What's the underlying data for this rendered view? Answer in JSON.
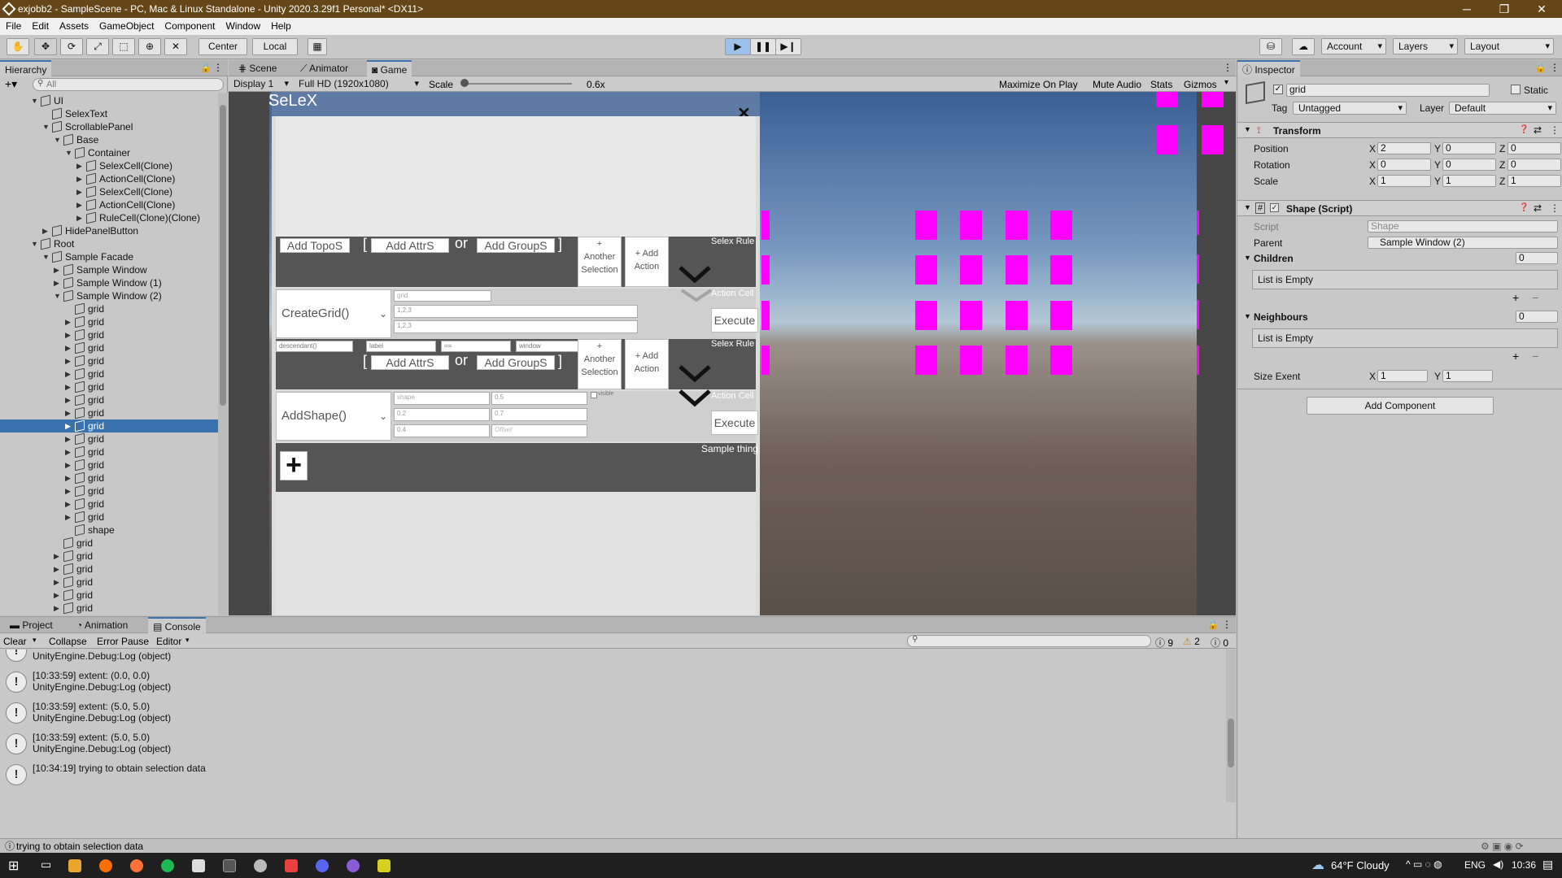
{
  "window": {
    "title": "exjobb2 - SampleScene - PC, Mac & Linux Standalone - Unity 2020.3.29f1 Personal* <DX11>",
    "minimize": "─",
    "maximize": "❐",
    "close": "✕"
  },
  "menu": [
    "File",
    "Edit",
    "Assets",
    "GameObject",
    "Component",
    "Window",
    "Help"
  ],
  "toolbar": {
    "center": "Center",
    "local": "Local",
    "account": "Account",
    "layers": "Layers",
    "layout": "Layout"
  },
  "hierarchy": {
    "tab": "Hierarchy",
    "search_placeholder": "All",
    "rows": [
      {
        "label": "UI",
        "indent": 0,
        "arrow": "▼"
      },
      {
        "label": "SelexText",
        "indent": 1,
        "arrow": ""
      },
      {
        "label": "ScrollablePanel",
        "indent": 1,
        "arrow": "▼"
      },
      {
        "label": "Base",
        "indent": 2,
        "arrow": "▼"
      },
      {
        "label": "Container",
        "indent": 3,
        "arrow": "▼"
      },
      {
        "label": "SelexCell(Clone)",
        "indent": 4,
        "arrow": "▶"
      },
      {
        "label": "ActionCell(Clone)",
        "indent": 4,
        "arrow": "▶"
      },
      {
        "label": "SelexCell(Clone)",
        "indent": 4,
        "arrow": "▶"
      },
      {
        "label": "ActionCell(Clone)",
        "indent": 4,
        "arrow": "▶"
      },
      {
        "label": "RuleCell(Clone)(Clone)",
        "indent": 4,
        "arrow": "▶"
      },
      {
        "label": "HidePanelButton",
        "indent": 1,
        "arrow": "▶"
      },
      {
        "label": "Root",
        "indent": 0,
        "arrow": "▼"
      },
      {
        "label": "Sample Facade",
        "indent": 1,
        "arrow": "▼"
      },
      {
        "label": "Sample Window",
        "indent": 2,
        "arrow": "▶"
      },
      {
        "label": "Sample Window (1)",
        "indent": 2,
        "arrow": "▶"
      },
      {
        "label": "Sample Window (2)",
        "indent": 2,
        "arrow": "▼"
      },
      {
        "label": "grid",
        "indent": 3,
        "arrow": ""
      },
      {
        "label": "grid",
        "indent": 3,
        "arrow": "▶"
      },
      {
        "label": "grid",
        "indent": 3,
        "arrow": "▶"
      },
      {
        "label": "grid",
        "indent": 3,
        "arrow": "▶"
      },
      {
        "label": "grid",
        "indent": 3,
        "arrow": "▶"
      },
      {
        "label": "grid",
        "indent": 3,
        "arrow": "▶"
      },
      {
        "label": "grid",
        "indent": 3,
        "arrow": "▶"
      },
      {
        "label": "grid",
        "indent": 3,
        "arrow": "▶"
      },
      {
        "label": "grid",
        "indent": 3,
        "arrow": "▶"
      },
      {
        "label": "grid",
        "indent": 3,
        "arrow": "▶",
        "selected": true
      },
      {
        "label": "grid",
        "indent": 3,
        "arrow": "▶"
      },
      {
        "label": "grid",
        "indent": 3,
        "arrow": "▶"
      },
      {
        "label": "grid",
        "indent": 3,
        "arrow": "▶"
      },
      {
        "label": "grid",
        "indent": 3,
        "arrow": "▶"
      },
      {
        "label": "grid",
        "indent": 3,
        "arrow": "▶"
      },
      {
        "label": "grid",
        "indent": 3,
        "arrow": "▶"
      },
      {
        "label": "grid",
        "indent": 3,
        "arrow": "▶"
      },
      {
        "label": "shape",
        "indent": 3,
        "arrow": ""
      },
      {
        "label": "grid",
        "indent": 2,
        "arrow": ""
      },
      {
        "label": "grid",
        "indent": 2,
        "arrow": "▶"
      },
      {
        "label": "grid",
        "indent": 2,
        "arrow": "▶"
      },
      {
        "label": "grid",
        "indent": 2,
        "arrow": "▶"
      },
      {
        "label": "grid",
        "indent": 2,
        "arrow": "▶"
      },
      {
        "label": "grid",
        "indent": 2,
        "arrow": "▶"
      }
    ]
  },
  "game": {
    "tabs": [
      "Scene",
      "Animator",
      "Game"
    ],
    "display": "Display 1",
    "resolution": "Full HD (1920x1080)",
    "scale_label": "Scale",
    "scale_value": "0.6x",
    "maximize": "Maximize On Play",
    "mute": "Mute Audio",
    "stats": "Stats",
    "gizmos": "Gizmos"
  },
  "selex": {
    "title": "SeLeX",
    "close": "✕",
    "add_topos": "Add TopoS",
    "bracket_open": "[",
    "bracket_close": "]",
    "add_attrs": "Add AttrS",
    "or": "or",
    "add_groups": "Add GroupS",
    "another_selection_plus": "+",
    "another_selection_1": "Another",
    "another_selection_2": "Selection",
    "add_action_1": "+ Add",
    "add_action_2": "Action",
    "selex_rule": "Selex Rule",
    "action_cell": "Action Cell",
    "create_grid": "CreateGrid()",
    "grid_in": "grid",
    "grid_v1": "1,2,3",
    "grid_v2": "1,2,3",
    "execute": "Execute",
    "descendant": "descendant()",
    "label": "label",
    "eq": "==",
    "window": "window",
    "visible": "visible",
    "add_shape": "AddShape()",
    "shape": "shape",
    "v05": "0.5",
    "v02": "0.2",
    "v07": "0.7",
    "v04": "0.4",
    "offset": "Offset",
    "sample_thing": "Sample thing",
    "plus": "+"
  },
  "inspector": {
    "tab": "Inspector",
    "name": "grid",
    "static": "Static",
    "tag_label": "Tag",
    "tag": "Untagged",
    "layer_label": "Layer",
    "layer": "Default",
    "transform": "Transform",
    "position": "Position",
    "rotation": "Rotation",
    "scale": "Scale",
    "x": "X",
    "y": "Y",
    "z": "Z",
    "pos": [
      "2",
      "0",
      "0"
    ],
    "rot": [
      "0",
      "0",
      "0"
    ],
    "scl": [
      "1",
      "1",
      "1"
    ],
    "shape_script": "Shape (Script)",
    "script_label": "Script",
    "script": "Shape",
    "parent_label": "Parent",
    "parent": "Sample Window (2)",
    "children": "Children",
    "children_count": "0",
    "empty": "List is Empty",
    "neighbours": "Neighbours",
    "neighbours_count": "0",
    "size_extent": "Size Exent",
    "size": [
      "1",
      "1"
    ],
    "add_component": "Add Component"
  },
  "console": {
    "tabs": [
      "Project",
      "Animation",
      "Console"
    ],
    "clear": "Clear",
    "collapse": "Collapse",
    "error_pause": "Error Pause",
    "editor": "Editor",
    "counts": [
      "9",
      "2",
      "0"
    ],
    "logs": [
      {
        "l1": "",
        "l2": "UnityEngine.Debug:Log (object)"
      },
      {
        "l1": "[10:33:59] extent: (0.0, 0.0)",
        "l2": "UnityEngine.Debug:Log (object)"
      },
      {
        "l1": "[10:33:59] extent: (5.0, 5.0)",
        "l2": "UnityEngine.Debug:Log (object)"
      },
      {
        "l1": "[10:33:59] extent: (5.0, 5.0)",
        "l2": "UnityEngine.Debug:Log (object)"
      },
      {
        "l1": "[10:34:19] trying to obtain selection data",
        "l2": ""
      }
    ]
  },
  "status": "trying to obtain selection data",
  "taskbar": {
    "weather": "64°F  Cloudy",
    "lang": "ENG",
    "time": "10:36"
  }
}
